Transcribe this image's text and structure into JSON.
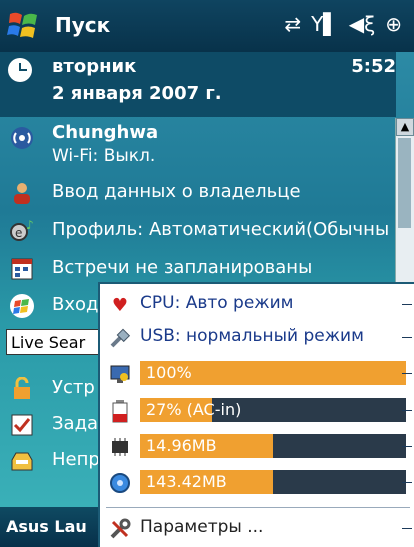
{
  "title_bar": {
    "title": "Пуск",
    "icons": [
      "sync-icon",
      "signal-icon",
      "volume-icon",
      "connection-icon"
    ]
  },
  "today": {
    "day": "вторник",
    "date": "2 января 2007 г.",
    "time": "5:52",
    "wifi_title": "Chunghwa",
    "wifi_status": "Wi-Fi: Выкл.",
    "items": [
      "Ввод данных о владельце",
      "Профиль: Автоматический(Обычны",
      "Встречи не запланированы",
      "Вход",
      "Устр",
      "Зада",
      "Непр"
    ],
    "search_text": "Live Sear"
  },
  "bottom_bar": {
    "label": "Asus Lau"
  },
  "popup": {
    "cpu_label": "CPU: Авто режим",
    "usb_label": "USB: нормальный режим",
    "bars": [
      {
        "name": "brightness",
        "text": "100%",
        "fraction": 1.0
      },
      {
        "name": "battery",
        "text": "27% (AC-in)",
        "fraction": 0.27
      },
      {
        "name": "memory",
        "text": "14.96MB",
        "fraction": 0.5
      },
      {
        "name": "storage",
        "text": "143.42MB",
        "fraction": 0.5
      }
    ],
    "settings_label": "Параметры ..."
  },
  "colors": {
    "accent": "#f0a030",
    "menu_text": "#1a3a8a",
    "bar_bg": "#2a3a4a"
  }
}
